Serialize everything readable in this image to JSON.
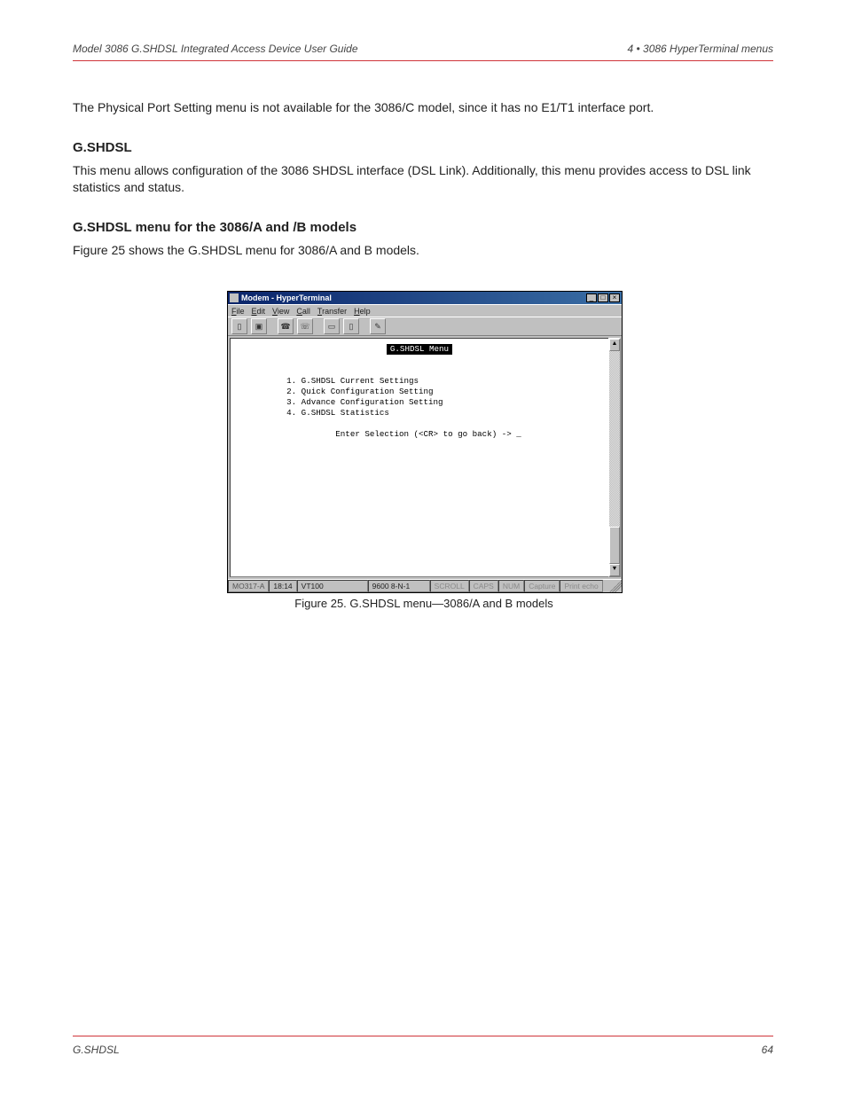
{
  "header": {
    "left": "Model 3086 G.SHDSL Integrated Access Device User Guide",
    "right": "4 • 3086 HyperTerminal menus"
  },
  "body": {
    "p0": "The Physical Port Setting menu is not available for the 3086/C model, since it has no E1/T1 interface port.",
    "h1": "G.SHDSL",
    "p1": "This menu allows configuration of the 3086 SHDSL interface (DSL Link). Additionally, this menu provides access to DSL link statistics and status.",
    "h2": "G.SHDSL menu for the 3086/A and /B models",
    "p2_a": "Figure",
    "p2_fig": "25",
    "p2_b": " shows the G.SHDSL menu for 3086/A and B models."
  },
  "window": {
    "title": "Modem - HyperTerminal",
    "controls": {
      "minimize": "_",
      "maximize": "□",
      "close": "×"
    },
    "menus": [
      "File",
      "Edit",
      "View",
      "Call",
      "Transfer",
      "Help"
    ],
    "toolbar_icons": [
      "new-doc-icon",
      "open-icon",
      "connect-icon",
      "disconnect-icon",
      "send-icon",
      "receive-icon",
      "properties-icon"
    ],
    "toolbar_glyphs": [
      "▯",
      "▣",
      "☎",
      "☏",
      "▭",
      "▯",
      "✎"
    ]
  },
  "terminal": {
    "banner": "G.SHDSL Menu",
    "items": [
      "1. G.SHDSL Current Settings",
      "2. Quick Configuration Setting",
      "3. Advance Configuration Setting",
      "4. G.SHDSL Statistics"
    ],
    "prompt": "Enter Selection (<CR> to go back) -> _"
  },
  "status": {
    "ref": "MO317-A",
    "time": "18:14",
    "term": "VT100",
    "conn": "9600 8-N-1",
    "scroll": "SCROLL",
    "caps": "CAPS",
    "num": "NUM",
    "capture": "Capture",
    "printecho": "Print echo"
  },
  "caption": {
    "prefix": "Figure 25.",
    "text": " G.SHDSL menu—3086/A and B models"
  },
  "footer": {
    "left": "G.SHDSL",
    "right": "64"
  },
  "scroll": {
    "up": "▲",
    "down": "▼"
  }
}
